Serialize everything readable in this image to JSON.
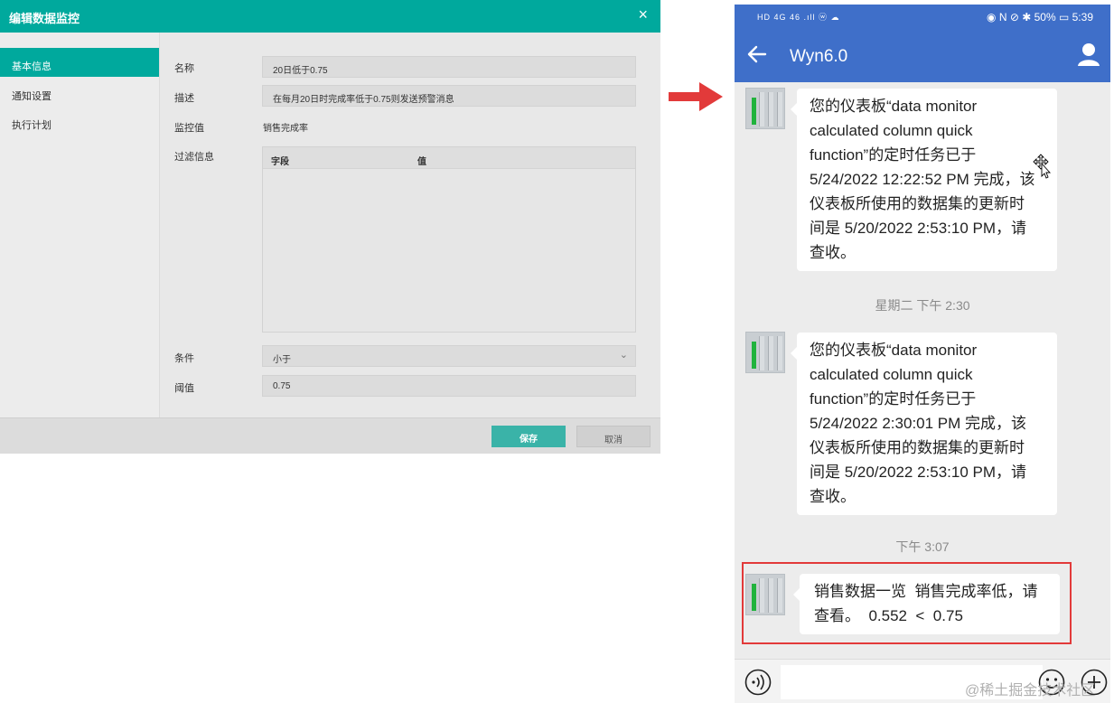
{
  "dialog": {
    "title": "编辑数据监控",
    "close": "×",
    "nav": [
      {
        "label": "基本信息"
      },
      {
        "label": "通知设置"
      },
      {
        "label": "执行计划"
      }
    ],
    "fields": {
      "name_label": "名称",
      "name_value": "20日低于0.75",
      "desc_label": "描述",
      "desc_value": "在每月20日时完成率低于0.75则发送预警消息",
      "monitor_label": "监控值",
      "monitor_value": "销售完成率",
      "filter_label": "过滤信息",
      "filter_columns": [
        "字段",
        "值"
      ],
      "condition_label": "条件",
      "condition_value": "小于",
      "threshold_label": "阈值",
      "threshold_value": "0.75"
    },
    "buttons": {
      "save": "保存",
      "cancel": "取消"
    }
  },
  "phone": {
    "statusbar": {
      "left": "HD 4G 46 .ıll ⓦ ☁",
      "right": "◉ N ⊘ ✱ 50% ▭ 5:39"
    },
    "app_title": "Wyn6.0",
    "messages": [
      {
        "text": "您的仪表板“data monitor calculated column quick function”的定时任务已于 5/24/2022 12:22:52 PM 完成，该仪表板所使用的数据集的更新时间是 5/20/2022 2:53:10 PM，请查收。"
      },
      {
        "timestamp": "星期二  下午 2:30"
      },
      {
        "text": "您的仪表板“data monitor calculated column quick function”的定时任务已于 5/24/2022 2:30:01 PM 完成，该仪表板所使用的数据集的更新时间是 5/20/2022 2:53:10 PM，请查收。"
      },
      {
        "timestamp": "下午 3:07"
      },
      {
        "text": "销售数据一览  销售完成率低，请查看。  0.552  <  0.75"
      }
    ]
  },
  "watermark": "@稀土掘金技术社区",
  "colors": {
    "teal": "#00a99d",
    "phone_blue": "#3f6fc9",
    "arrow_red": "#e23a3a",
    "highlight_red": "#e23a3a"
  }
}
